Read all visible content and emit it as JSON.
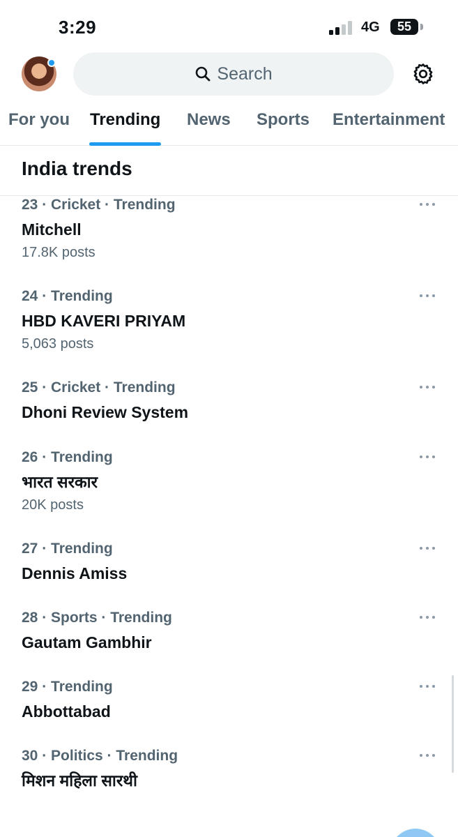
{
  "status_bar": {
    "time": "3:29",
    "network": "4G",
    "battery": "55"
  },
  "header": {
    "search_placeholder": "Search"
  },
  "tabs": [
    {
      "label": "For you"
    },
    {
      "label": "Trending"
    },
    {
      "label": "News"
    },
    {
      "label": "Sports"
    },
    {
      "label": "Entertainment"
    }
  ],
  "active_tab": "Trending",
  "section_title": "India trends",
  "trends": [
    {
      "meta": "23 · Cricket · Trending",
      "name": "Mitchell",
      "posts": "17.8K posts"
    },
    {
      "meta": "24 · Trending",
      "name": "HBD KAVERI PRIYAM",
      "posts": "5,063 posts"
    },
    {
      "meta": "25 · Cricket · Trending",
      "name": "Dhoni Review System",
      "posts": ""
    },
    {
      "meta": "26 · Trending",
      "name": "भारत सरकार",
      "posts": "20K posts"
    },
    {
      "meta": "27 · Trending",
      "name": "Dennis Amiss",
      "posts": ""
    },
    {
      "meta": "28 · Sports · Trending",
      "name": "Gautam Gambhir",
      "posts": ""
    },
    {
      "meta": "29 · Trending",
      "name": "Abbottabad",
      "posts": ""
    },
    {
      "meta": "30 · Politics · Trending",
      "name": "मिशन महिला सारथी",
      "posts": ""
    }
  ],
  "colors": {
    "accent": "#1d9bf0",
    "secondary_text": "#536471",
    "primary_text": "#0f1419"
  },
  "icons": [
    "search-icon",
    "gear-icon",
    "more-icon",
    "avatar",
    "signal-icon",
    "battery-icon"
  ]
}
